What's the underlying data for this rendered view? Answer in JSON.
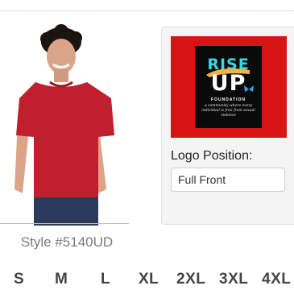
{
  "product": {
    "style_number": "Style #5140UD",
    "shirt_color": "#c0202e"
  },
  "logo_panel": {
    "frame_color": "#d61414",
    "logo_rise": "RISE",
    "logo_up": "UP",
    "logo_foundation": "FOUNDATION",
    "logo_tagline": "a community where every individual is free from sexual violence",
    "label": "Logo Position:",
    "selected_position": "Full Front"
  },
  "sizes": [
    "S",
    "M",
    "L",
    "XL",
    "2XL",
    "3XL",
    "4XL"
  ]
}
